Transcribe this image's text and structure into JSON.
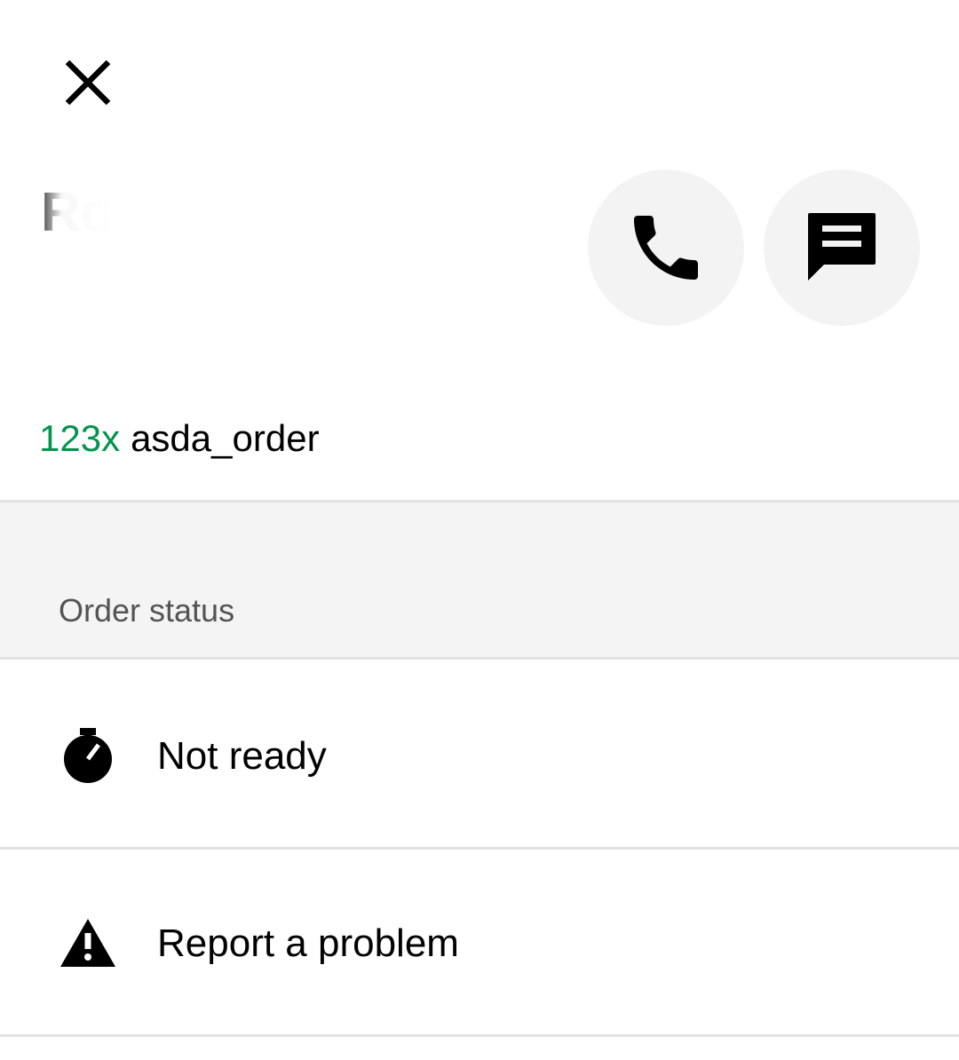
{
  "header": {
    "close_icon": "close-icon",
    "customer_name": "Robert H."
  },
  "actions": {
    "call_icon": "phone-icon",
    "message_icon": "message-icon"
  },
  "order": {
    "quantity": "123x",
    "item_name": "asda_order",
    "quantity_color": "#05944f"
  },
  "order_status_section": {
    "title": "Order status",
    "rows": [
      {
        "icon": "stopwatch-icon",
        "label": "Not ready"
      },
      {
        "icon": "warning-icon",
        "label": "Report a problem"
      }
    ]
  },
  "colors": {
    "section_background": "#f4f4f4",
    "circle_button_background": "#f3f3f3",
    "divider": "#e2e2e2"
  }
}
